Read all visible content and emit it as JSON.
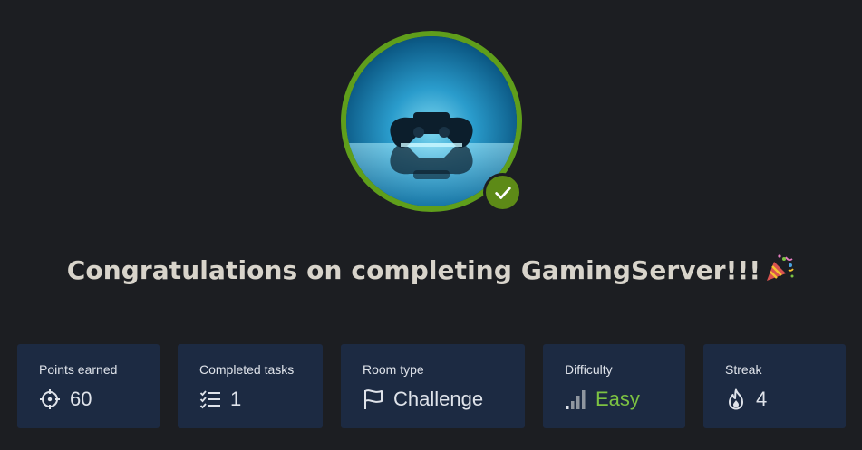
{
  "room": {
    "name": "GamingServer",
    "congrats_text": "Congratulations on completing GamingServer!!!",
    "avatar_icon": "gamepad-image",
    "completed_badge_icon": "check-icon"
  },
  "stats": [
    {
      "label": "Points earned",
      "value": "60",
      "icon": "crosshair-icon"
    },
    {
      "label": "Completed tasks",
      "value": "1",
      "icon": "checklist-icon"
    },
    {
      "label": "Room type",
      "value": "Challenge",
      "icon": "flag-icon"
    },
    {
      "label": "Difficulty",
      "value": "Easy",
      "icon": "signal-bars-icon"
    },
    {
      "label": "Streak",
      "value": "4",
      "icon": "flame-icon"
    }
  ],
  "colors": {
    "background": "#1c1e22",
    "card_background": "#1c2a42",
    "success_green": "#5f9e1b",
    "easy_green": "#7cc242"
  }
}
